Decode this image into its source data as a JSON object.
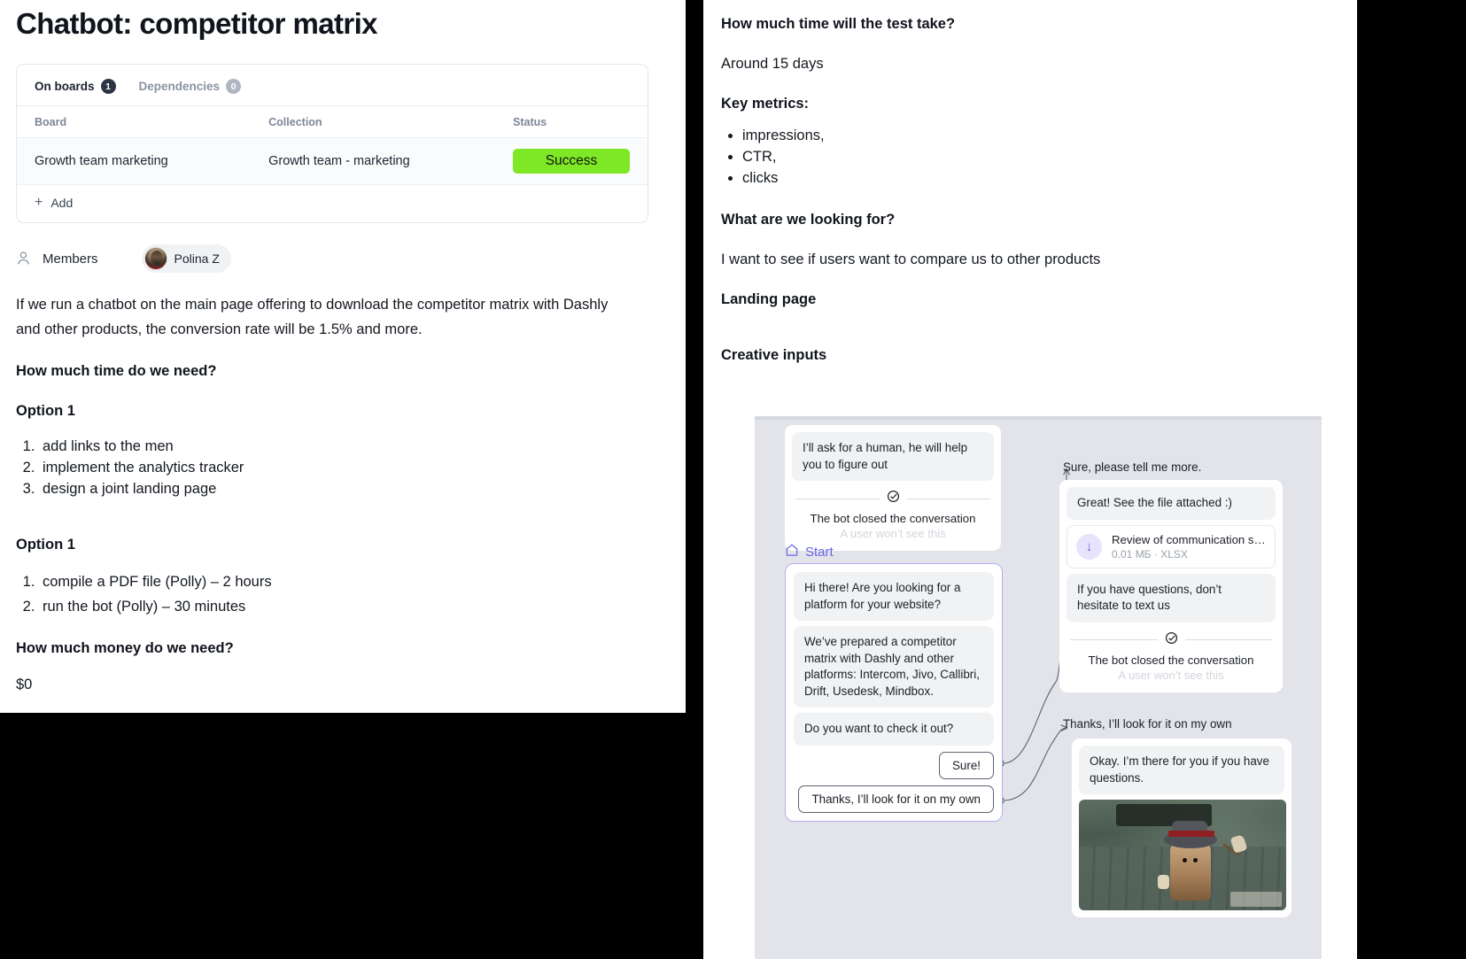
{
  "left": {
    "title": "Chatbot: competitor matrix",
    "boards_card": {
      "tabs": [
        {
          "label": "On boards",
          "count": "1",
          "active": true
        },
        {
          "label": "Dependencies",
          "count": "0",
          "active": false
        }
      ],
      "columns": [
        "Board",
        "Collection",
        "Status"
      ],
      "rows": [
        {
          "board": "Growth team marketing",
          "collection": "Growth team - marketing",
          "status": "Success",
          "status_color": "#7ee827"
        }
      ],
      "add_label": "Add"
    },
    "members": {
      "label": "Members",
      "chip_name": "Polina Z"
    },
    "intro": "If we run a chatbot on the main page offering to download the competitor matrix with Dashly and other products, the conversion rate will be 1.5% and more.",
    "h_time": "How much time do we need?",
    "option1_a_title": "Option 1",
    "option1_a_items": [
      "add links to the men",
      "implement the analytics tracker",
      "design a joint landing page"
    ],
    "option1_b_title": "Option 1",
    "option1_b_items": [
      "compile a PDF file (Polly) – 2 hours",
      "run the bot (Polly) – 30 minutes"
    ],
    "h_money": "How much money do we need?",
    "money_value": "$0"
  },
  "right": {
    "h_test_time": "How much time will the test take?",
    "test_time_value": "Around 15 days",
    "h_key_metrics": "Key metrics:",
    "key_metrics": [
      "impressions,",
      "CTR,",
      "clicks"
    ],
    "h_looking_for": "What are we looking for?",
    "looking_for_value": "I want to see if users want to compare us to other products",
    "h_landing_page": "Landing page",
    "h_creative_inputs": "Creative inputs"
  },
  "flow": {
    "top_node": {
      "bubble": "I’ll ask for a human, he will help you to figure out",
      "closed_text": "The bot closed the conversation",
      "closed_sub": "A user won’t see this"
    },
    "start": {
      "label": "Start",
      "bubbles": [
        "Hi there! Are you looking for a platform for your website?",
        "We’ve prepared a competitor matrix with Dashly and other platforms: Intercom, Jivo, Callibri, Drift, Usedesk, Mindbox.",
        "Do you want to check it out?"
      ],
      "buttons": [
        "Sure!",
        "Thanks, I’ll look for it on my own"
      ]
    },
    "branch_sure": {
      "edge_label": "Sure, please tell me more.",
      "bubbles": [
        "Great! See the file attached :)"
      ],
      "attachment": {
        "name": "Review of communication ser...",
        "meta": "0.01 МБ · XLSX"
      },
      "bubble_after": "If you have questions, don’t hesitate to text us",
      "closed_text": "The bot closed the conversation",
      "closed_sub": "A user won’t see this"
    },
    "branch_thanks": {
      "edge_label": "Thanks, I’ll look for it on my own",
      "bubble": "Okay. I’m there for you if you have questions."
    }
  }
}
